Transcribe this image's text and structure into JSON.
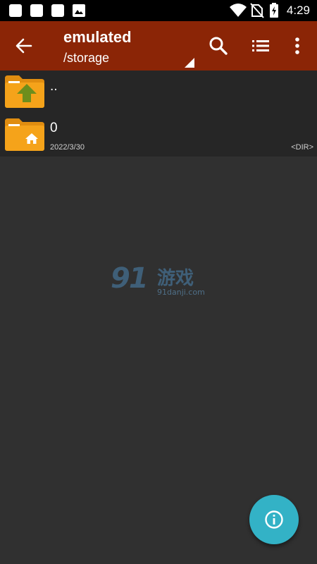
{
  "status_bar": {
    "time": "4:29",
    "left_icons": [
      "notification-icon",
      "notification-icon",
      "notification-icon",
      "image-icon"
    ],
    "right_icons": [
      "wifi-icon",
      "no-sim-icon",
      "battery-charging-icon"
    ]
  },
  "toolbar": {
    "title": "emulated",
    "path": "/storage",
    "color": "#8b2506",
    "actions": [
      "back-arrow-icon",
      "search-icon",
      "list-view-icon",
      "more-vert-icon"
    ]
  },
  "files": [
    {
      "name": "..",
      "icon": "folder-up-icon"
    },
    {
      "name": "0",
      "date": "2022/3/30",
      "type": "<DIR>",
      "icon": "folder-home-icon"
    }
  ],
  "watermark": {
    "number": "91",
    "chinese": "游戏",
    "url": "91danji.com"
  },
  "fab": {
    "icon": "info-icon",
    "color": "#33b2c6"
  },
  "colors": {
    "background": "#303030",
    "list_background": "#262626",
    "folder": "#f5a31a"
  }
}
